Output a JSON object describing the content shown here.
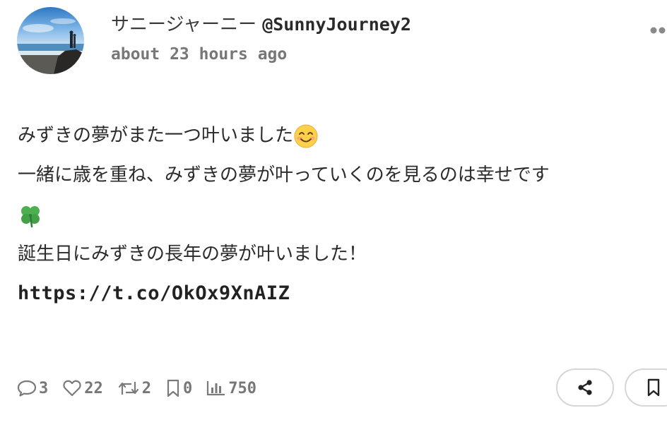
{
  "post": {
    "author": {
      "display_name": "サニージャーニー",
      "handle": "@SunnyJourney2",
      "avatar_icon": "beach-photo-avatar"
    },
    "timestamp": "about 23 hours ago",
    "more_icon": "ellipsis-icon",
    "body": {
      "line1": "みずきの夢がまた一つ叶いました",
      "line1_emoji": "smiling-face-emoji",
      "line2": "一緒に歳を重ね、みずきの夢が叶っていくのを見るのは幸せです",
      "line3_emoji": "four-leaf-clover-emoji",
      "line4": "誕生日にみずきの長年の夢が叶いました！",
      "link": "https://t.co/OkOx9XnAIZ"
    },
    "stats": {
      "replies": "3",
      "likes": "22",
      "reposts": "2",
      "bookmarks": "0",
      "views": "750"
    },
    "actions": {
      "share_icon": "share-icon",
      "bookmark_icon": "bookmark-icon"
    }
  },
  "colors": {
    "text": "#2b2b2b",
    "muted": "#777777",
    "border": "#d6d6d6",
    "background": "#ffffff"
  }
}
